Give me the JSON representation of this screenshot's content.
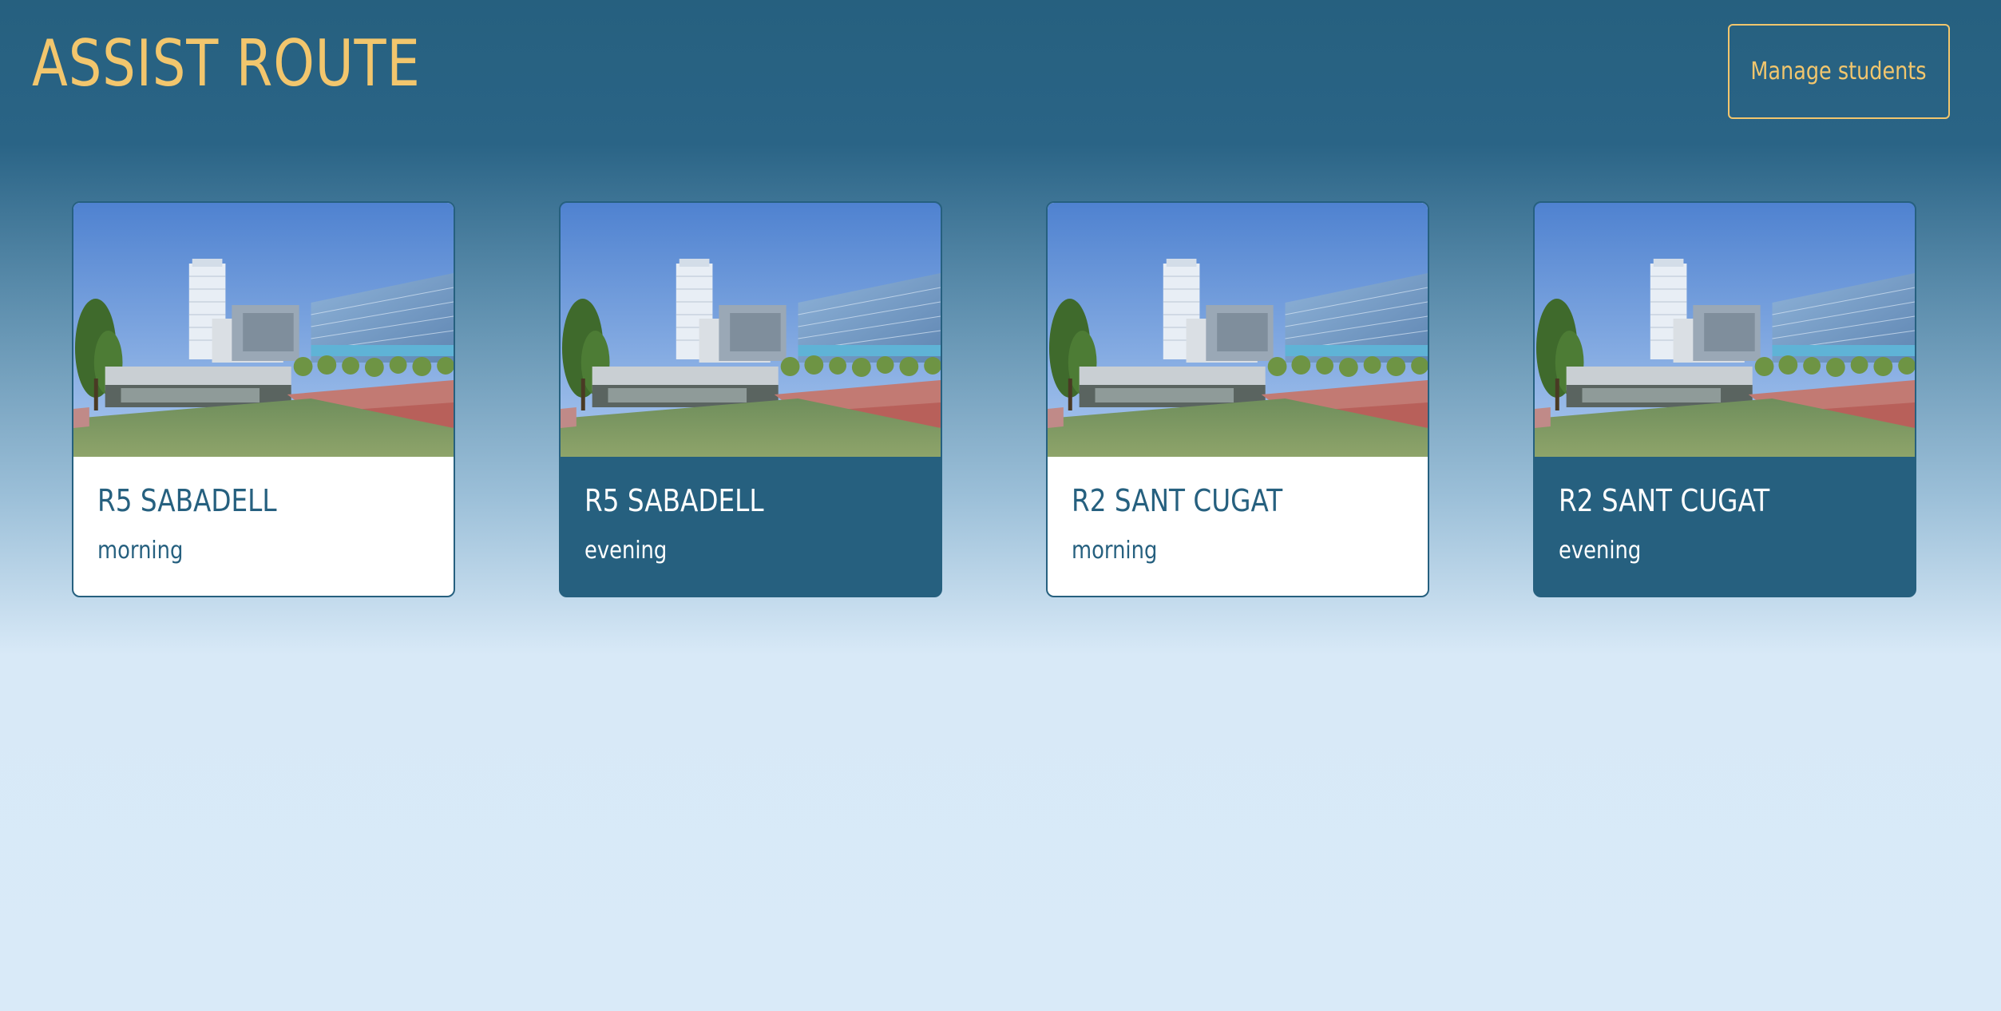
{
  "header": {
    "title": "ASSIST ROUTE",
    "manage_button_label": "Manage students"
  },
  "colors": {
    "brand_dark": "#26607f",
    "accent_yellow": "#f2c66d",
    "background_light": "#d9eaf8"
  },
  "routes": [
    {
      "name": "R5 SABADELL",
      "shift": "morning",
      "style": "light",
      "image": "station-plaza-photo"
    },
    {
      "name": "R5 SABADELL",
      "shift": "evening",
      "style": "dark",
      "image": "station-plaza-photo"
    },
    {
      "name": "R2 SANT CUGAT",
      "shift": "morning",
      "style": "light",
      "image": "station-plaza-photo"
    },
    {
      "name": "R2 SANT CUGAT",
      "shift": "evening",
      "style": "dark",
      "image": "station-plaza-photo"
    }
  ]
}
